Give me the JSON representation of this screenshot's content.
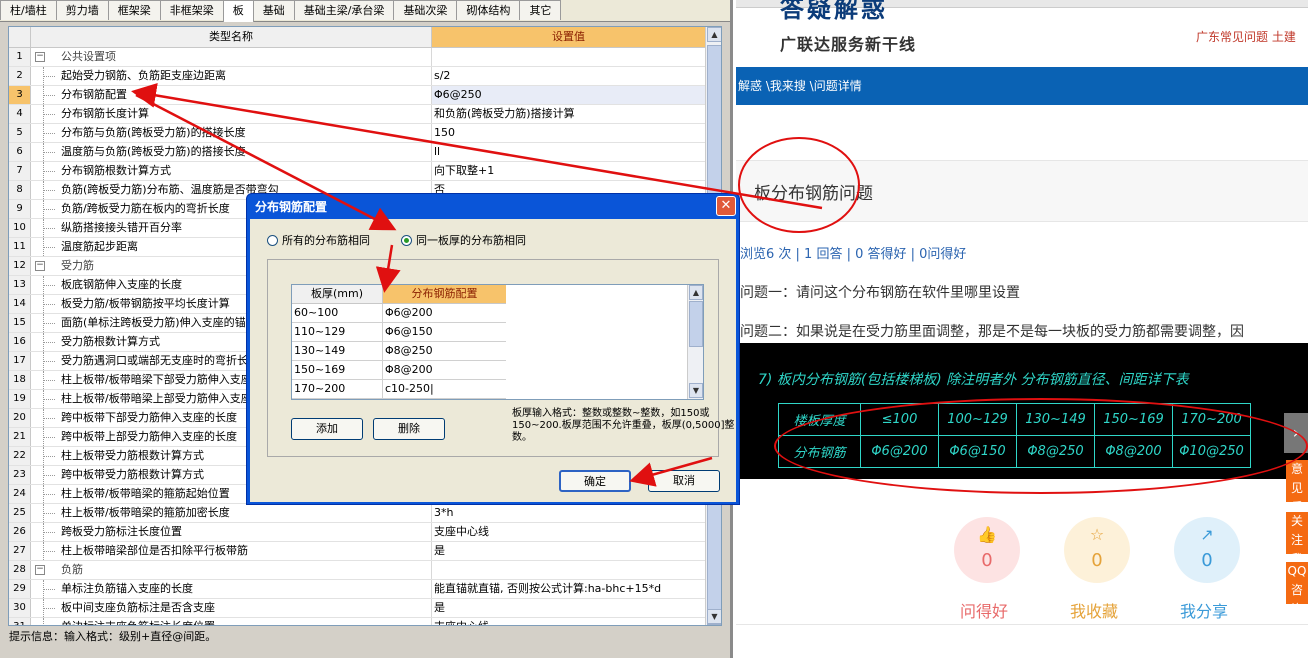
{
  "app": {
    "tabs": [
      "柱/墙柱",
      "剪力墙",
      "框架梁",
      "非框架梁",
      "板",
      "基础",
      "基础主梁/承台梁",
      "基础次梁",
      "砌体结构",
      "其它"
    ],
    "active_tab": "板",
    "grid": {
      "col_name": "类型名称",
      "col_value": "设置值",
      "rows": [
        {
          "n": "1",
          "name": "公共设置项",
          "value": "",
          "group": true,
          "pm": "−"
        },
        {
          "n": "2",
          "name": "起始受力钢筋、负筋距支座边距离",
          "value": "s/2"
        },
        {
          "n": "3",
          "name": "分布钢筋配置",
          "value": "Φ6@250",
          "selected": true
        },
        {
          "n": "4",
          "name": "分布钢筋长度计算",
          "value": "和负筋(跨板受力筋)搭接计算"
        },
        {
          "n": "5",
          "name": "分布筋与负筋(跨板受力筋)的搭接长度",
          "value": "150"
        },
        {
          "n": "6",
          "name": "温度筋与负筋(跨板受力筋)的搭接长度",
          "value": "ll"
        },
        {
          "n": "7",
          "name": "分布钢筋根数计算方式",
          "value": "向下取整+1"
        },
        {
          "n": "8",
          "name": "负筋(跨板受力筋)分布筋、温度筋是否带弯勾",
          "value": "否"
        },
        {
          "n": "9",
          "name": "负筋/跨板受力筋在板内的弯折长度",
          "value": ""
        },
        {
          "n": "10",
          "name": "纵筋搭接接头错开百分率",
          "value": ""
        },
        {
          "n": "11",
          "name": "温度筋起步距离",
          "value": ""
        },
        {
          "n": "12",
          "name": "受力筋",
          "value": "",
          "group": true,
          "pm": "−"
        },
        {
          "n": "13",
          "name": "板底钢筋伸入支座的长度",
          "value": ""
        },
        {
          "n": "14",
          "name": "板受力筋/板带钢筋按平均长度计算",
          "value": ""
        },
        {
          "n": "15",
          "name": "面筋(单标注跨板受力筋)伸入支座的锚固长度",
          "value": ""
        },
        {
          "n": "16",
          "name": "受力筋根数计算方式",
          "value": ""
        },
        {
          "n": "17",
          "name": "受力筋遇洞口或端部无支座时的弯折长度",
          "value": ""
        },
        {
          "n": "18",
          "name": "柱上板带/板带暗梁下部受力筋伸入支座的长度",
          "value": ""
        },
        {
          "n": "19",
          "name": "柱上板带/板带暗梁上部受力筋伸入支座的长度",
          "value": ""
        },
        {
          "n": "20",
          "name": "跨中板带下部受力筋伸入支座的长度",
          "value": ""
        },
        {
          "n": "21",
          "name": "跨中板带上部受力筋伸入支座的长度",
          "value": ""
        },
        {
          "n": "22",
          "name": "柱上板带受力筋根数计算方式",
          "value": ""
        },
        {
          "n": "23",
          "name": "跨中板带受力筋根数计算方式",
          "value": ""
        },
        {
          "n": "24",
          "name": "柱上板带/板带暗梁的箍筋起始位置",
          "value": ""
        },
        {
          "n": "25",
          "name": "柱上板带/板带暗梁的箍筋加密长度",
          "value": "3*h"
        },
        {
          "n": "26",
          "name": "跨板受力筋标注长度位置",
          "value": "支座中心线"
        },
        {
          "n": "27",
          "name": "柱上板带暗梁部位是否扣除平行板带筋",
          "value": "是"
        },
        {
          "n": "28",
          "name": "负筋",
          "value": "",
          "group": true,
          "pm": "−"
        },
        {
          "n": "29",
          "name": "单标注负筋锚入支座的长度",
          "value": "能直锚就直锚, 否则按公式计算:ha-bhc+15*d"
        },
        {
          "n": "30",
          "name": "板中间支座负筋标注是否含支座",
          "value": "是"
        },
        {
          "n": "31",
          "name": "单边标注支座负筋标注长度位置",
          "value": "支座中心线"
        }
      ]
    },
    "hint": "提示信息：输入格式：级别+直径@间距。"
  },
  "dialog": {
    "title": "分布钢筋配置",
    "close": "✕",
    "radio_all": "所有的分布筋相同",
    "radio_same": "同一板厚的分布筋相同",
    "table": {
      "col_thick": "板厚(mm)",
      "col_config": "分布钢筋配置",
      "rows": [
        {
          "thick": "60~100",
          "config": "Φ6@200"
        },
        {
          "thick": "110~129",
          "config": "Φ6@150"
        },
        {
          "thick": "130~149",
          "config": "Φ8@250"
        },
        {
          "thick": "150~169",
          "config": "Φ8@200"
        },
        {
          "thick": "170~200",
          "config": "c10-250|"
        }
      ]
    },
    "add": "添加",
    "delete": "删除",
    "format_note": "板厚输入格式：整数或整数~整数，如150或150~200.板厚范围不允许重叠，板厚(0,5000]整数。",
    "ok": "确定",
    "cancel": "取消"
  },
  "web": {
    "logo_top": "答疑解惑",
    "logo_sub": "广联达服务新干线",
    "top_links": "广东常见问题   土建",
    "breadcrumb": "解惑 \\我来搜 \\问题详情",
    "question_title": "板分布钢筋问题",
    "stats": "浏览6 次 | 1 回答 | 0 答得好 | 0问得好",
    "q1": "问题一：请问这个分布钢筋在软件里哪里设置",
    "q2": "问题二：如果说是在受力筋里面调整，那是不是每一块板的受力筋都需要调整，因",
    "cad": {
      "title": "7) 板内分布钢筋(包括楼梯板) 除注明者外 分布钢筋直径、间距详下表",
      "header": [
        "楼板厚度",
        "≤100",
        "100~129",
        "130~149",
        "150~169",
        "170~200"
      ],
      "values": [
        "分布钢筋",
        "Φ6@200",
        "Φ6@150",
        "Φ8@250",
        "Φ8@200",
        "Φ10@250"
      ]
    },
    "side_buttons": [
      "意见反馈",
      "关注我们",
      "QQ咨询"
    ],
    "actions": [
      {
        "label": "问得好",
        "count": "0",
        "icon": "👍",
        "bg": "#fde3e3",
        "color": "#e86a6a"
      },
      {
        "label": "我收藏",
        "count": "0",
        "icon": "☆",
        "bg": "#fdf1d9",
        "color": "#e5a33a"
      },
      {
        "label": "我分享",
        "count": "0",
        "icon": "↗",
        "bg": "#dff0fa",
        "color": "#3a9ad8"
      }
    ],
    "arrow": "›"
  }
}
